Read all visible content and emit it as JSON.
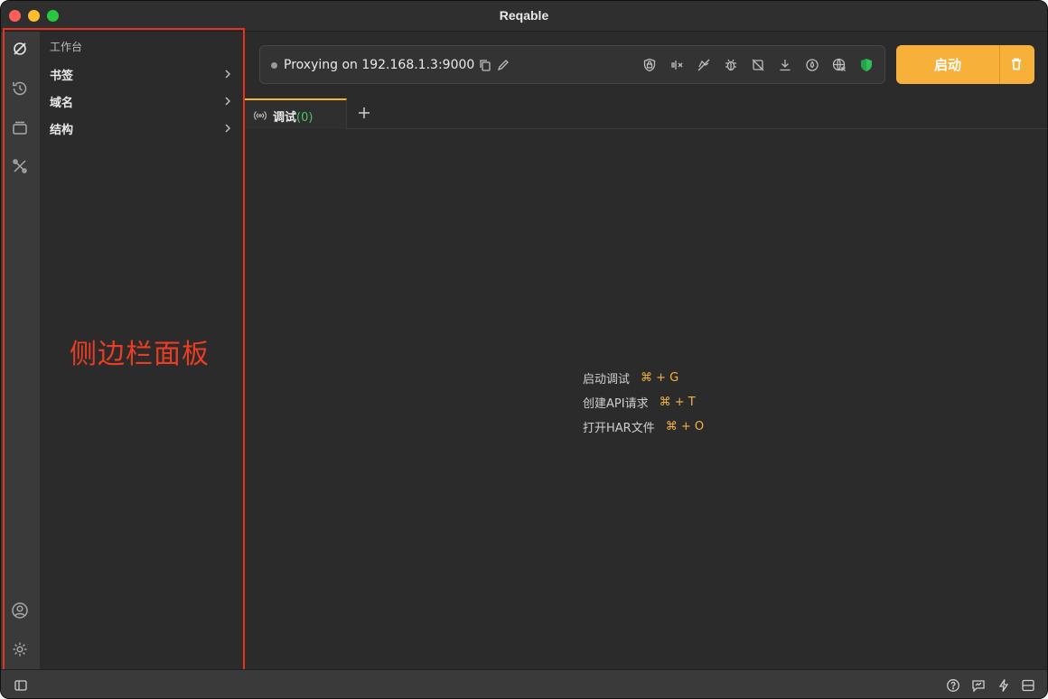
{
  "window": {
    "title": "Reqable"
  },
  "sidebar": {
    "header": "工作台",
    "items": [
      {
        "label": "书签"
      },
      {
        "label": "域名"
      },
      {
        "label": "结构"
      }
    ]
  },
  "annotation": "侧边栏面板",
  "proxy": {
    "status": "Proxying on 192.168.1.3:9000"
  },
  "start_button": {
    "label": "启动"
  },
  "tabs": [
    {
      "label": "调试",
      "count": "(0)"
    }
  ],
  "shortcuts": [
    {
      "label": "启动调试",
      "key": "⌘ + G"
    },
    {
      "label": "创建API请求",
      "key": "⌘ + T"
    },
    {
      "label": "打开HAR文件",
      "key": "⌘ + O"
    }
  ],
  "colors": {
    "accent": "#f7b03a",
    "annotation": "#e8321c",
    "success": "#4cc36b"
  }
}
